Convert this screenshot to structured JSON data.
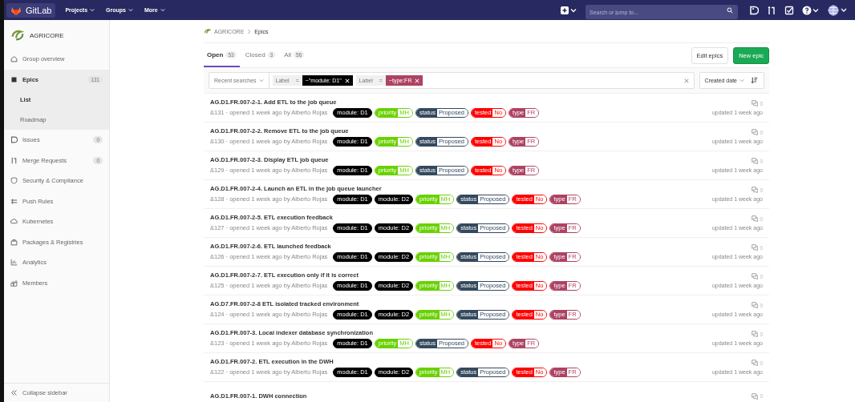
{
  "topbar": {
    "logo": "GitLab",
    "menus": [
      {
        "label": "Projects"
      },
      {
        "label": "Groups"
      },
      {
        "label": "More"
      }
    ],
    "search": {
      "placeholder": "Search or jump to..."
    }
  },
  "sidebar": {
    "group": "AGRICORE",
    "items": [
      {
        "label": "Group overview",
        "selected": false
      },
      {
        "label": "Epics",
        "count": "131",
        "selected": true,
        "expanded": true,
        "children": [
          {
            "label": "List",
            "selected": true
          },
          {
            "label": "Roadmap",
            "selected": false
          }
        ]
      },
      {
        "label": "Issues",
        "count": "0",
        "selected": false
      },
      {
        "label": "Merge Requests",
        "count": "0",
        "selected": false
      },
      {
        "label": "Security & Compliance",
        "selected": false
      },
      {
        "label": "Push Rules",
        "selected": false
      },
      {
        "label": "Kubernetes",
        "selected": false
      },
      {
        "label": "Packages & Registries",
        "selected": false
      },
      {
        "label": "Analytics",
        "selected": false
      },
      {
        "label": "Members",
        "selected": false
      }
    ],
    "collapse": "Collapse sidebar"
  },
  "breadcrumb": [
    "AGRICORE",
    "Epics"
  ],
  "tabs": [
    {
      "label": "Open",
      "count": "53",
      "selected": true
    },
    {
      "label": "Closed",
      "count": "3",
      "selected": false
    },
    {
      "label": "All",
      "count": "56",
      "selected": false
    }
  ],
  "buttons": [
    {
      "label": "Edit epics",
      "kind": "default"
    },
    {
      "label": "New epic",
      "kind": "primary"
    }
  ],
  "filter": {
    "recent": "Recent searches",
    "tokens": [
      {
        "field": "Label",
        "operator": "=",
        "value": "~\"module: D1\"",
        "color": "#000000"
      },
      {
        "field": "Label",
        "operator": "=",
        "value": "~type:FR",
        "color": "#ad4363"
      }
    ],
    "sort": "Created date"
  },
  "epics": [
    {
      "title": "AG.D1.FR.007-2-1. Add ETL to the job queue",
      "meta": "&131 · opened 1 week ago by Alberto Rojas",
      "comments": "0",
      "updated": "updated 1 week ago",
      "labels": [
        {
          "kind": "plain",
          "text": "module: D1",
          "color": "#000000"
        },
        {
          "kind": "scoped",
          "key": "priority",
          "value": "MH",
          "color": "#69d100"
        },
        {
          "kind": "scoped",
          "key": "status",
          "value": "Proposed",
          "color": "#34495e"
        },
        {
          "kind": "scoped",
          "key": "tested",
          "value": "No",
          "color": "#ff0000"
        },
        {
          "kind": "scoped",
          "key": "type",
          "value": "FR",
          "color": "#ad4363"
        }
      ]
    },
    {
      "title": "AG.D1.FR.007-2-2. Remove ETL to the job queue",
      "meta": "&130 · opened 1 week ago by Alberto Rojas",
      "comments": "0",
      "updated": "updated 1 week ago",
      "labels": [
        {
          "kind": "plain",
          "text": "module: D1",
          "color": "#000000"
        },
        {
          "kind": "scoped",
          "key": "priority",
          "value": "MH",
          "color": "#69d100"
        },
        {
          "kind": "scoped",
          "key": "status",
          "value": "Proposed",
          "color": "#34495e"
        },
        {
          "kind": "scoped",
          "key": "tested",
          "value": "No",
          "color": "#ff0000"
        },
        {
          "kind": "scoped",
          "key": "type",
          "value": "FR",
          "color": "#ad4363"
        }
      ]
    },
    {
      "title": "AG.D1.FR.007-2-3. Display ETL job queue",
      "meta": "&129 · opened 1 week ago by Alberto Rojas",
      "comments": "0",
      "updated": "updated 1 week ago",
      "labels": [
        {
          "kind": "plain",
          "text": "module: D1",
          "color": "#000000"
        },
        {
          "kind": "scoped",
          "key": "priority",
          "value": "MH",
          "color": "#69d100"
        },
        {
          "kind": "scoped",
          "key": "status",
          "value": "Proposed",
          "color": "#34495e"
        },
        {
          "kind": "scoped",
          "key": "tested",
          "value": "No",
          "color": "#ff0000"
        },
        {
          "kind": "scoped",
          "key": "type",
          "value": "FR",
          "color": "#ad4363"
        }
      ]
    },
    {
      "title": "AG.D1.FR.007-2-4. Launch an ETL in the job queue launcher",
      "meta": "&128 · opened 1 week ago by Alberto Rojas",
      "comments": "0",
      "updated": "updated 1 week ago",
      "labels": [
        {
          "kind": "plain",
          "text": "module: D1",
          "color": "#000000"
        },
        {
          "kind": "plain",
          "text": "module: D2",
          "color": "#000000"
        },
        {
          "kind": "scoped",
          "key": "priority",
          "value": "MH",
          "color": "#69d100"
        },
        {
          "kind": "scoped",
          "key": "status",
          "value": "Proposed",
          "color": "#34495e"
        },
        {
          "kind": "scoped",
          "key": "tested",
          "value": "No",
          "color": "#ff0000"
        },
        {
          "kind": "scoped",
          "key": "type",
          "value": "FR",
          "color": "#ad4363"
        }
      ]
    },
    {
      "title": "AG.D1.FR.007-2-5. ETL execution feedback",
      "meta": "&127 · opened 1 week ago by Alberto Rojas",
      "comments": "0",
      "updated": "updated 1 week ago",
      "labels": [
        {
          "kind": "plain",
          "text": "module: D1",
          "color": "#000000"
        },
        {
          "kind": "plain",
          "text": "module: D2",
          "color": "#000000"
        },
        {
          "kind": "scoped",
          "key": "priority",
          "value": "MH",
          "color": "#69d100"
        },
        {
          "kind": "scoped",
          "key": "status",
          "value": "Proposed",
          "color": "#34495e"
        },
        {
          "kind": "scoped",
          "key": "tested",
          "value": "No",
          "color": "#ff0000"
        },
        {
          "kind": "scoped",
          "key": "type",
          "value": "FR",
          "color": "#ad4363"
        }
      ]
    },
    {
      "title": "AG.D1.FR.007-2-6. ETL launched feedback",
      "meta": "&126 · opened 1 week ago by Alberto Rojas",
      "comments": "0",
      "updated": "updated 1 week ago",
      "labels": [
        {
          "kind": "plain",
          "text": "module: D1",
          "color": "#000000"
        },
        {
          "kind": "plain",
          "text": "module: D2",
          "color": "#000000"
        },
        {
          "kind": "scoped",
          "key": "priority",
          "value": "MH",
          "color": "#69d100"
        },
        {
          "kind": "scoped",
          "key": "status",
          "value": "Proposed",
          "color": "#34495e"
        },
        {
          "kind": "scoped",
          "key": "tested",
          "value": "No",
          "color": "#ff0000"
        },
        {
          "kind": "scoped",
          "key": "type",
          "value": "FR",
          "color": "#ad4363"
        }
      ]
    },
    {
      "title": "AG.D1.FR.007-2-7. ETL execution only if it is correct",
      "meta": "&125 · opened 1 week ago by Alberto Rojas",
      "comments": "0",
      "updated": "updated 1 week ago",
      "labels": [
        {
          "kind": "plain",
          "text": "module: D1",
          "color": "#000000"
        },
        {
          "kind": "plain",
          "text": "module: D2",
          "color": "#000000"
        },
        {
          "kind": "scoped",
          "key": "priority",
          "value": "MH",
          "color": "#69d100"
        },
        {
          "kind": "scoped",
          "key": "status",
          "value": "Proposed",
          "color": "#34495e"
        },
        {
          "kind": "scoped",
          "key": "tested",
          "value": "No",
          "color": "#ff0000"
        },
        {
          "kind": "scoped",
          "key": "type",
          "value": "FR",
          "color": "#ad4363"
        }
      ]
    },
    {
      "title": "AG.D7.FR.007-2-8 ETL isolated tracked environment",
      "meta": "&124 · opened 1 week ago by Alberto Rojas",
      "comments": "0",
      "updated": "updated 1 week ago",
      "labels": [
        {
          "kind": "plain",
          "text": "module: D1",
          "color": "#000000"
        },
        {
          "kind": "plain",
          "text": "module: D2",
          "color": "#000000"
        },
        {
          "kind": "scoped",
          "key": "priority",
          "value": "MH",
          "color": "#69d100"
        },
        {
          "kind": "scoped",
          "key": "status",
          "value": "Proposed",
          "color": "#34495e"
        },
        {
          "kind": "scoped",
          "key": "tested",
          "value": "No",
          "color": "#ff0000"
        },
        {
          "kind": "scoped",
          "key": "type",
          "value": "FR",
          "color": "#ad4363"
        }
      ]
    },
    {
      "title": "AG.D1.FR.007-3. Local indexer database synchronization",
      "meta": "&123 · opened 1 week ago by Alberto Rojas",
      "comments": "0",
      "updated": "updated 1 week ago",
      "labels": [
        {
          "kind": "plain",
          "text": "module: D1",
          "color": "#000000"
        },
        {
          "kind": "scoped",
          "key": "priority",
          "value": "MH",
          "color": "#69d100"
        },
        {
          "kind": "scoped",
          "key": "status",
          "value": "Proposed",
          "color": "#34495e"
        },
        {
          "kind": "scoped",
          "key": "tested",
          "value": "No",
          "color": "#ff0000"
        },
        {
          "kind": "scoped",
          "key": "type",
          "value": "FR",
          "color": "#ad4363"
        }
      ]
    },
    {
      "title": "AG.D1.FR.007-2. ETL execution in the DWH",
      "meta": "&122 · opened 1 week ago by Alberto Rojas",
      "comments": "0",
      "updated": "updated 1 week ago",
      "labels": [
        {
          "kind": "plain",
          "text": "module: D1",
          "color": "#000000"
        },
        {
          "kind": "plain",
          "text": "module: D2",
          "color": "#000000"
        },
        {
          "kind": "scoped",
          "key": "priority",
          "value": "MH",
          "color": "#69d100"
        },
        {
          "kind": "scoped",
          "key": "status",
          "value": "Proposed",
          "color": "#34495e"
        },
        {
          "kind": "scoped",
          "key": "tested",
          "value": "No",
          "color": "#ff0000"
        },
        {
          "kind": "scoped",
          "key": "type",
          "value": "FR",
          "color": "#ad4363"
        }
      ]
    },
    {
      "title": "AG.D1.FR.007-1. DWH connection",
      "comments": "0"
    }
  ]
}
